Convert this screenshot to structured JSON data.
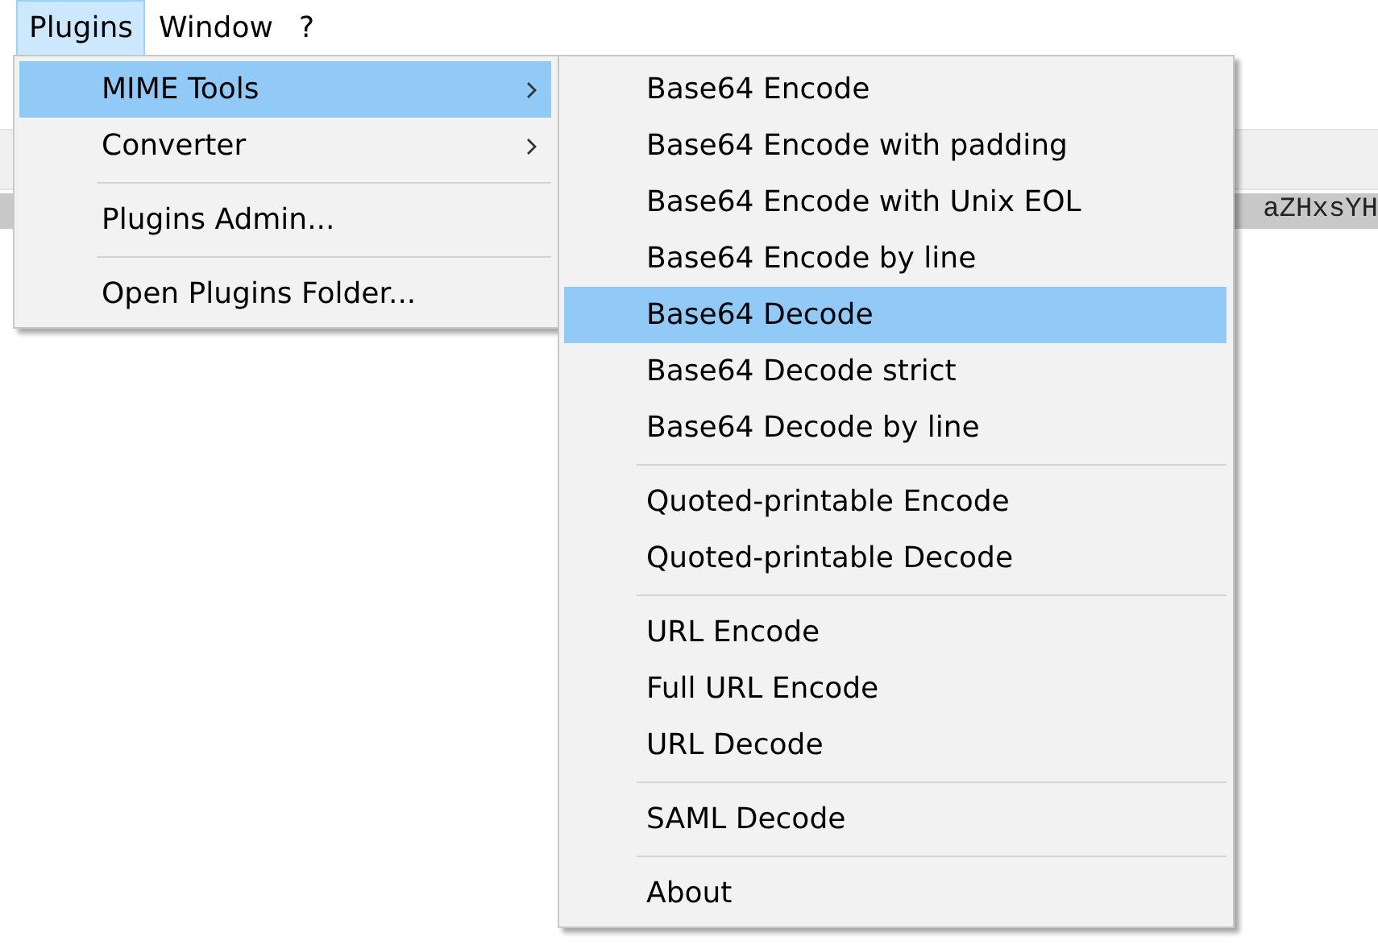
{
  "menu_bar": [
    {
      "label": "Plugins",
      "selected": true
    },
    {
      "label": "Window",
      "selected": false
    },
    {
      "label": "?",
      "selected": false
    }
  ],
  "editor": {
    "line_fragment": "aZHxsYH"
  },
  "plugins_menu": {
    "items": [
      {
        "kind": "item",
        "label": "MIME Tools",
        "submenu": true,
        "selected": true
      },
      {
        "kind": "item",
        "label": "Converter",
        "submenu": true,
        "selected": false
      },
      {
        "kind": "separator"
      },
      {
        "kind": "item",
        "label": "Plugins Admin...",
        "submenu": false,
        "selected": false
      },
      {
        "kind": "separator"
      },
      {
        "kind": "item",
        "label": "Open Plugins Folder...",
        "submenu": false,
        "selected": false
      }
    ]
  },
  "mime_tools_submenu": {
    "items": [
      {
        "kind": "item",
        "label": "Base64 Encode",
        "selected": false
      },
      {
        "kind": "item",
        "label": "Base64 Encode with padding",
        "selected": false
      },
      {
        "kind": "item",
        "label": "Base64 Encode with Unix EOL",
        "selected": false
      },
      {
        "kind": "item",
        "label": "Base64 Encode by line",
        "selected": false
      },
      {
        "kind": "item",
        "label": "Base64 Decode",
        "selected": true
      },
      {
        "kind": "item",
        "label": "Base64 Decode strict",
        "selected": false
      },
      {
        "kind": "item",
        "label": "Base64 Decode by line",
        "selected": false
      },
      {
        "kind": "separator"
      },
      {
        "kind": "item",
        "label": "Quoted-printable Encode",
        "selected": false
      },
      {
        "kind": "item",
        "label": "Quoted-printable Decode",
        "selected": false
      },
      {
        "kind": "separator"
      },
      {
        "kind": "item",
        "label": "URL Encode",
        "selected": false
      },
      {
        "kind": "item",
        "label": "Full URL Encode",
        "selected": false
      },
      {
        "kind": "item",
        "label": "URL Decode",
        "selected": false
      },
      {
        "kind": "separator"
      },
      {
        "kind": "item",
        "label": "SAML Decode",
        "selected": false
      },
      {
        "kind": "separator"
      },
      {
        "kind": "item",
        "label": "About",
        "selected": false
      }
    ]
  }
}
